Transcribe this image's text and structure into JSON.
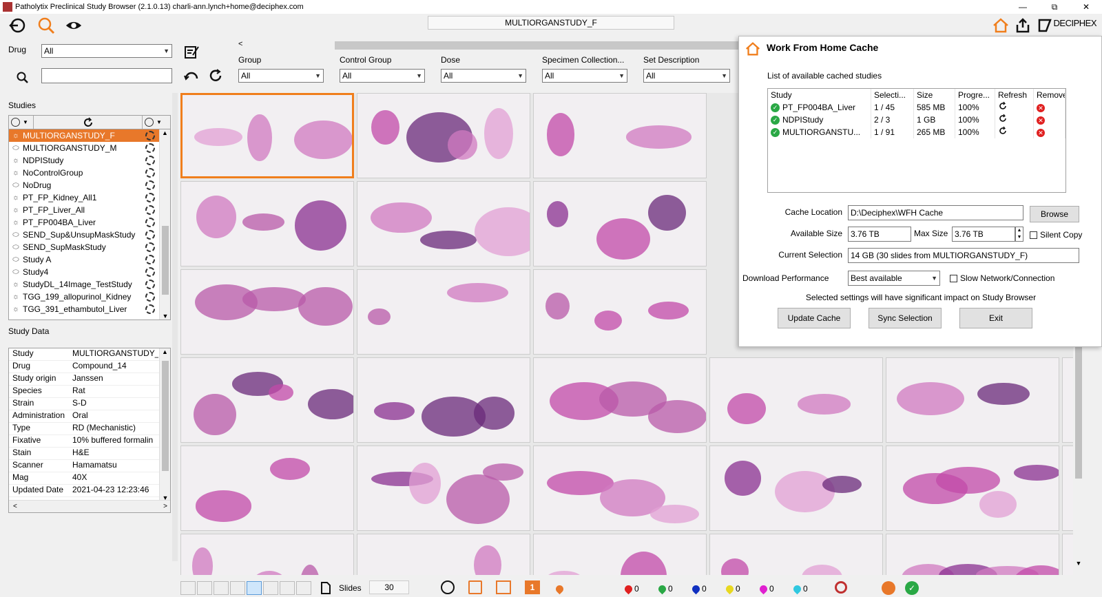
{
  "window": {
    "title": "Patholytix Preclinical Study Browser (2.1.0.13)  charli-ann.lynch+home@deciphex.com",
    "controls": [
      "—",
      "⧉",
      "✕"
    ]
  },
  "toolbar": {
    "study_name": "MULTIORGANSTUDY_F",
    "brand": "DECIPHEX"
  },
  "left": {
    "drug_label": "Drug",
    "drug_value": "All",
    "studies_label": "Studies",
    "studies": [
      {
        "name": "MULTIORGANSTUDY_F",
        "selected": true
      },
      {
        "name": "MULTIORGANSTUDY_M",
        "selected": false
      },
      {
        "name": "NDPIStudy",
        "selected": false
      },
      {
        "name": "NoControlGroup",
        "selected": false
      },
      {
        "name": "NoDrug",
        "selected": false
      },
      {
        "name": "PT_FP_Kidney_All1",
        "selected": false
      },
      {
        "name": "PT_FP_Liver_All",
        "selected": false
      },
      {
        "name": "PT_FP004BA_Liver",
        "selected": false
      },
      {
        "name": "SEND_Sup&UnsupMaskStudy",
        "selected": false
      },
      {
        "name": "SEND_SupMaskStudy",
        "selected": false
      },
      {
        "name": "Study A",
        "selected": false
      },
      {
        "name": "Study4",
        "selected": false
      },
      {
        "name": "StudyDL_14Image_TestStudy",
        "selected": false
      },
      {
        "name": "TGG_199_allopurinol_Kidney",
        "selected": false
      },
      {
        "name": "TGG_391_ethambutol_Liver",
        "selected": false
      }
    ],
    "study_data_label": "Study Data",
    "study_data": [
      {
        "k": "Study",
        "v": "MULTIORGANSTUDY_"
      },
      {
        "k": "Drug",
        "v": "Compound_14"
      },
      {
        "k": "Study origin",
        "v": "Janssen"
      },
      {
        "k": "Species",
        "v": "Rat"
      },
      {
        "k": "Strain",
        "v": "S-D"
      },
      {
        "k": "Administration",
        "v": "Oral"
      },
      {
        "k": "Type",
        "v": "RD (Mechanistic)"
      },
      {
        "k": "Fixative",
        "v": "10% buffered formalin"
      },
      {
        "k": "Stain",
        "v": "H&E"
      },
      {
        "k": "Scanner",
        "v": "Hamamatsu"
      },
      {
        "k": "Mag",
        "v": "40X"
      },
      {
        "k": "Updated Date",
        "v": "2021-04-23 12:23:46"
      }
    ]
  },
  "filters": [
    {
      "label": "Group",
      "value": "All"
    },
    {
      "label": "Control Group",
      "value": "All"
    },
    {
      "label": "Dose",
      "value": "All"
    },
    {
      "label": "Specimen Collection...",
      "value": "All"
    },
    {
      "label": "Set Description",
      "value": "All"
    }
  ],
  "wfh": {
    "title": "Work From Home Cache",
    "list_label": "List of available cached studies",
    "columns": [
      "Study",
      "Selecti...",
      "Size",
      "Progre...",
      "Refresh",
      "Remove"
    ],
    "rows": [
      {
        "study": "PT_FP004BA_Liver",
        "selection": "1 / 45",
        "size": "585 MB",
        "progress": "100%"
      },
      {
        "study": "NDPIStudy",
        "selection": "2 / 3",
        "size": "1 GB",
        "progress": "100%"
      },
      {
        "study": "MULTIORGANSTU...",
        "selection": "1 / 91",
        "size": "265 MB",
        "progress": "100%"
      }
    ],
    "cache_location_label": "Cache Location",
    "cache_location": "D:\\Deciphex\\WFH Cache",
    "browse": "Browse",
    "available_size_label": "Available Size",
    "available_size": "3.76 TB",
    "max_size_label": "Max Size",
    "max_size": "3.76 TB",
    "silent_copy": "Silent Copy",
    "current_selection_label": "Current Selection",
    "current_selection": "14 GB (30 slides from MULTIORGANSTUDY_F)",
    "download_perf_label": "Download Performance",
    "download_perf": "Best available",
    "slow_network": "Slow Network/Connection",
    "note": "Selected settings will have significant impact on Study Browser",
    "update_cache": "Update Cache",
    "sync_selection": "Sync Selection",
    "exit": "Exit"
  },
  "statusbar": {
    "slides_label": "Slides",
    "slides_count": "30",
    "marker_counts": [
      "0",
      "0",
      "0",
      "0",
      "0",
      "0"
    ],
    "marker_colors": [
      "#e02020",
      "#2aa845",
      "#1030c0",
      "#e8d820",
      "#e020d0",
      "#30c8e0"
    ]
  }
}
